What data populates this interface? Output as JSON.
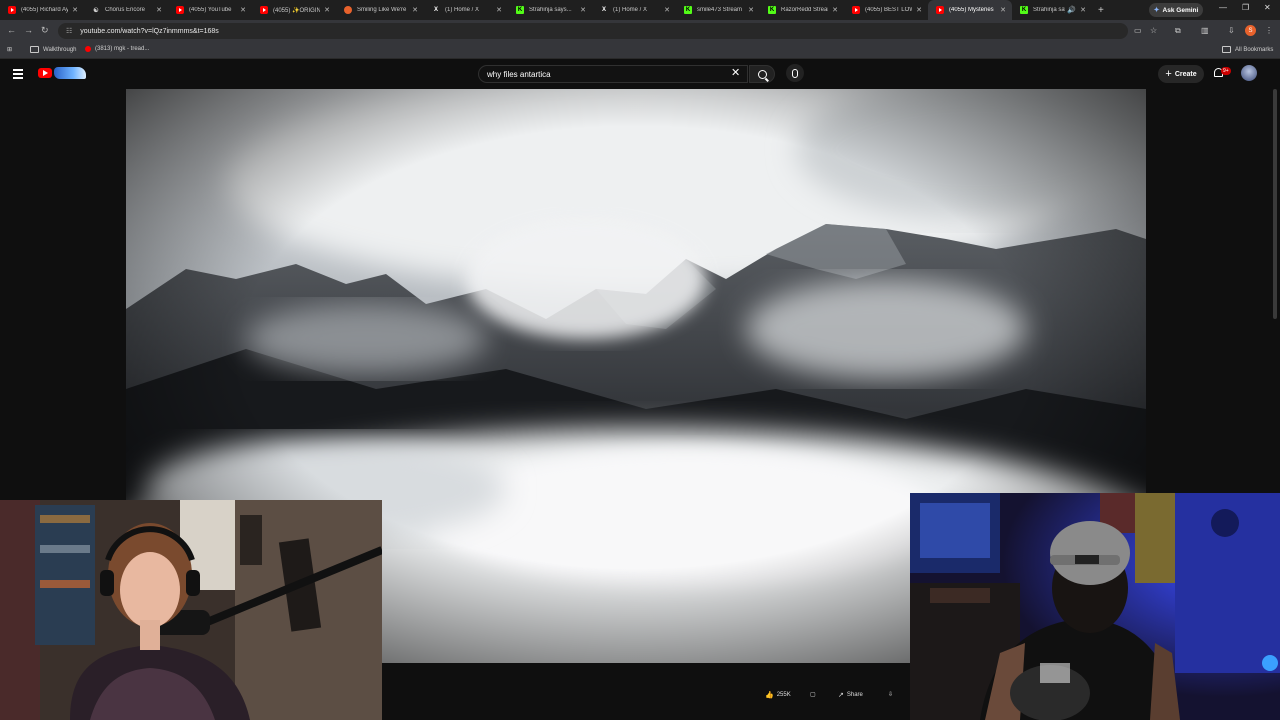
{
  "browser": {
    "tabs": [
      {
        "icon": "youtube-icon",
        "title": "(4055) Richard Ay",
        "active": false
      },
      {
        "icon": "chorus-icon",
        "title": "Chorus Encore",
        "active": false
      },
      {
        "icon": "youtube-icon",
        "title": "(4055) YouTube",
        "active": false
      },
      {
        "icon": "youtube-icon",
        "title": "(4055) ✨ORIGIN",
        "active": false
      },
      {
        "icon": "smiling-icon",
        "title": "Smiling Like We're",
        "active": false
      },
      {
        "icon": "x-icon",
        "title": "(1) Home / X",
        "active": false
      },
      {
        "icon": "kick-icon",
        "title": "Strahinja says...",
        "active": false
      },
      {
        "icon": "x-icon",
        "title": "(1) Home / X",
        "active": false
      },
      {
        "icon": "kick-icon",
        "title": "smile473 Stream",
        "active": false
      },
      {
        "icon": "kick-icon",
        "title": "RazorRedd Stream",
        "active": false
      },
      {
        "icon": "youtube-icon",
        "title": "(4055) BEST LOW",
        "active": false
      },
      {
        "icon": "youtube-icon",
        "title": "(4055) Mysteries",
        "active": true
      },
      {
        "icon": "kick-icon",
        "title": "Strahinja says",
        "active": false
      }
    ],
    "new_tab": "+",
    "gemini_label": "Ask Gemini",
    "url": "youtube.com/watch?v=lQz7inmmms&t=168s",
    "profile_initial": "S",
    "bookmarks": [
      {
        "label": "Walkthrough",
        "icon": "folder-icon"
      },
      {
        "label": "(3813) mgk - tread...",
        "icon": "youtube-icon"
      }
    ],
    "all_bookmarks": "All Bookmarks"
  },
  "youtube": {
    "search_value": "why files antartica",
    "create_label": "Create",
    "notification_badge": "9+"
  },
  "controls": {
    "like_count": "255K",
    "share_label": "Share"
  },
  "colors": {
    "youtube_red": "#ff0000",
    "kick_green": "#53fc18",
    "chrome_dark": "#35363a",
    "page_bg": "#0f0f0f"
  }
}
